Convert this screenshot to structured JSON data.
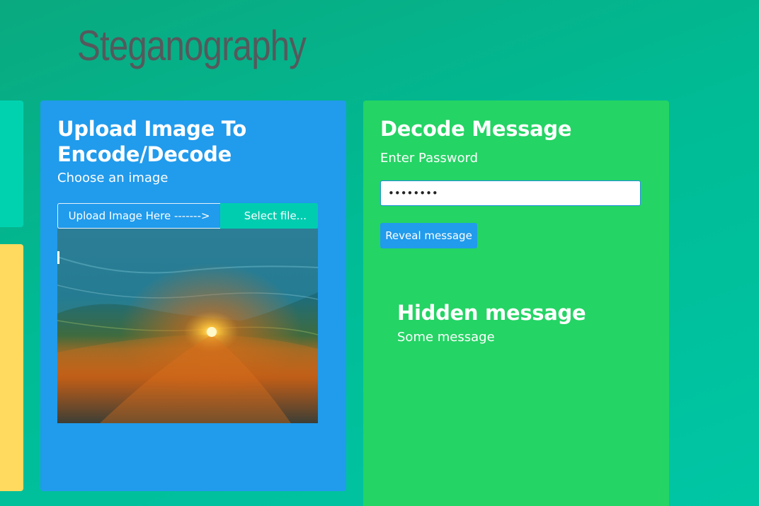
{
  "header": {
    "title": "Steganography"
  },
  "upload_card": {
    "heading": "Upload Image To Encode/Decode",
    "subheading": "Choose an image",
    "file_label": "Upload Image Here ------->",
    "file_button": "Select file..."
  },
  "decode_card": {
    "heading": "Decode Message",
    "password_label": "Enter Password",
    "password_value": "••••••••",
    "reveal_button": "Reveal message",
    "hidden_title": "Hidden message",
    "hidden_text": "Some message"
  },
  "colors": {
    "background": "#00bb95",
    "upload_card": "#219bec",
    "decode_card": "#24d464",
    "side_teal": "#00d2b0",
    "side_yellow": "#ffda5e",
    "file_button": "#00cdb0"
  }
}
